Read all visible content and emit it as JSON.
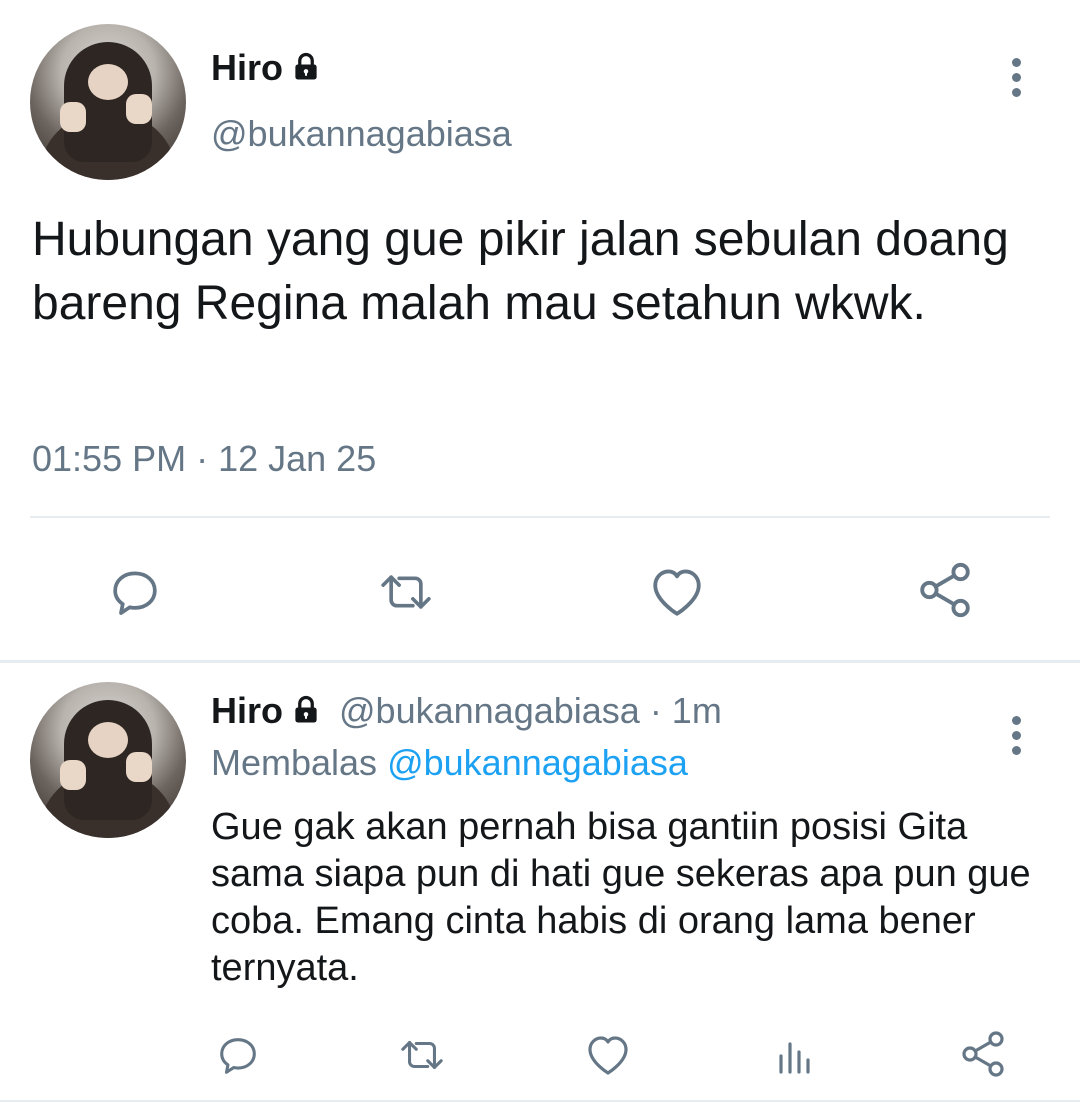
{
  "tweet": {
    "author_name": "Hiro",
    "author_handle": "@bukannagabiasa",
    "text": "Hubungan yang gue pikir jalan sebulan doang bareng Regina malah mau setahun wkwk.",
    "timestamp": "01:55 PM · 12 Jan 25",
    "actions": [
      "reply-icon",
      "retweet-icon",
      "like-icon",
      "share-icon"
    ]
  },
  "reply": {
    "author_name": "Hiro",
    "author_handle": "@bukannagabiasa",
    "time_ago": "· 1m",
    "replying_label": "Membalas",
    "replying_to": "@bukannagabiasa",
    "text": "Gue gak akan pernah bisa gantiin posisi Gita sama siapa pun di hati gue sekeras apa pun gue coba. Emang cinta habis di orang lama bener ternyata.",
    "actions": [
      "reply-icon",
      "retweet-icon",
      "like-icon",
      "analytics-icon",
      "share-icon"
    ]
  },
  "colors": {
    "text_primary": "#14171a",
    "text_secondary": "#657786",
    "link": "#1da1f2",
    "divider": "#e6ecf0"
  }
}
